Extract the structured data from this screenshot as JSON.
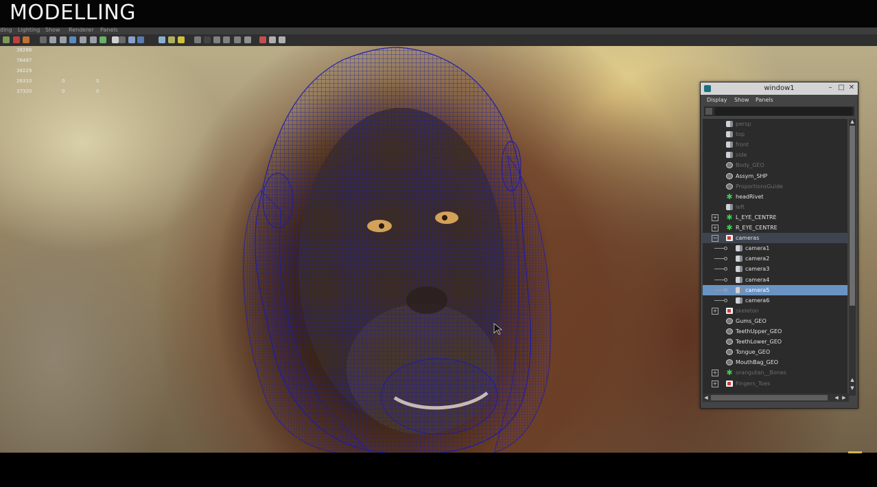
{
  "overlay_title": "MODELLING",
  "maya": {
    "main_menu": [
      "ding",
      "Lighting",
      "Show",
      "Renderer",
      "Panels"
    ],
    "hud_stats": [
      {
        "a": "38268",
        "b": "",
        "c": ""
      },
      {
        "a": "76497",
        "b": "",
        "c": ""
      },
      {
        "a": "38229",
        "b": "",
        "c": ""
      },
      {
        "a": "26310",
        "b": "0",
        "c": "0"
      },
      {
        "a": "37320",
        "b": "0",
        "c": "0"
      }
    ]
  },
  "outliner": {
    "title": "window1",
    "menu": [
      "Display",
      "Show",
      "Panels"
    ],
    "search": {
      "value": ""
    },
    "items": [
      {
        "label": "persp",
        "icon": "camera-icon",
        "dim": true
      },
      {
        "label": "top",
        "icon": "camera-icon",
        "dim": true
      },
      {
        "label": "front",
        "icon": "camera-icon",
        "dim": true
      },
      {
        "label": "side",
        "icon": "camera-icon",
        "dim": true
      },
      {
        "label": "Body_GEO",
        "icon": "mesh-icon",
        "dim": true
      },
      {
        "label": "Assym_SHP",
        "icon": "mesh-icon",
        "dim": false
      },
      {
        "label": "ProportionsGuide",
        "icon": "mesh-icon",
        "dim": true
      },
      {
        "label": "headRivet",
        "icon": "locator-icon",
        "dim": false
      },
      {
        "label": "left",
        "icon": "camera-icon",
        "dim": true
      },
      {
        "label": "L_EYE_CENTRE",
        "icon": "locator-icon",
        "dim": false,
        "expander": "+"
      },
      {
        "label": "R_EYE_CENTRE",
        "icon": "locator-icon",
        "dim": false,
        "expander": "+"
      },
      {
        "label": "cameras",
        "icon": "group-icon",
        "dim": false,
        "expander": "−",
        "group": true
      },
      {
        "label": "camera1",
        "icon": "camera-icon",
        "dim": false,
        "child": true
      },
      {
        "label": "camera2",
        "icon": "camera-icon",
        "dim": false,
        "child": true
      },
      {
        "label": "camera3",
        "icon": "camera-icon",
        "dim": false,
        "child": true
      },
      {
        "label": "camera4",
        "icon": "camera-icon",
        "dim": false,
        "child": true
      },
      {
        "label": "camera5",
        "icon": "camera-icon",
        "dim": false,
        "child": true,
        "selected": true
      },
      {
        "label": "camera6",
        "icon": "camera-icon",
        "dim": false,
        "child": true
      },
      {
        "label": "skeleton",
        "icon": "group-icon",
        "dim": true,
        "expander": "+"
      },
      {
        "label": "Gums_GEO",
        "icon": "mesh-icon",
        "dim": false
      },
      {
        "label": "TeethUpper_GEO",
        "icon": "mesh-icon",
        "dim": false
      },
      {
        "label": "TeethLower_GEO",
        "icon": "mesh-icon",
        "dim": false
      },
      {
        "label": "Tongue_GEO",
        "icon": "mesh-icon",
        "dim": false
      },
      {
        "label": "MouthBag_GEO",
        "icon": "mesh-icon",
        "dim": false
      },
      {
        "label": "orangutan__Bones",
        "icon": "locator-icon",
        "dim": true,
        "expander": "+"
      },
      {
        "label": "Fingers_Toes",
        "icon": "group-icon",
        "dim": true,
        "expander": "+"
      }
    ]
  },
  "colors": {
    "wireframe": "#1b1bb0",
    "selection": "#6a93c4",
    "joint": "#3bd14c"
  }
}
